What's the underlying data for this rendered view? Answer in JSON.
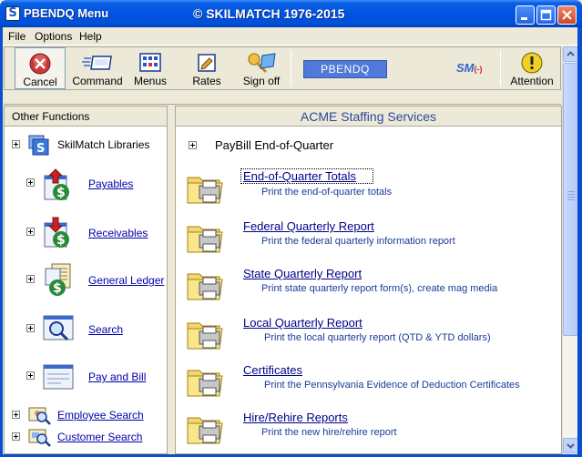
{
  "window": {
    "title": "PBENDQ Menu",
    "copyright": "© SKILMATCH 1976-2015",
    "app_icon_letter": "S"
  },
  "menubar": {
    "items": [
      "File",
      "Options",
      "Help"
    ]
  },
  "toolbar": {
    "buttons": [
      {
        "label": "Cancel",
        "icon": "cancel-icon"
      },
      {
        "label": "Command",
        "icon": "command-icon"
      },
      {
        "label": "Menus",
        "icon": "menus-icon"
      },
      {
        "label": "Rates",
        "icon": "rates-icon"
      },
      {
        "label": "Sign off",
        "icon": "sign-off-icon"
      },
      {
        "label": "Attention",
        "icon": "attention-icon"
      }
    ],
    "code": "PBENDQ",
    "logo": "SM",
    "logo_mark": "(-)"
  },
  "left_pane": {
    "header": "Other Functions",
    "items": [
      {
        "label": "SkilMatch Libraries",
        "icon": "libraries-icon",
        "link": false
      },
      {
        "label": "Payables",
        "icon": "payables-icon",
        "link": true
      },
      {
        "label": "Receivables",
        "icon": "receivables-icon",
        "link": true
      },
      {
        "label": "General Ledger",
        "icon": "general-ledger-icon",
        "link": true
      },
      {
        "label": "Search",
        "icon": "search-icon",
        "link": true
      },
      {
        "label": "Pay and Bill",
        "icon": "pay-and-bill-icon",
        "link": true
      },
      {
        "label": "Employee Search",
        "icon": "employee-search-icon",
        "link": true
      },
      {
        "label": "Customer Search",
        "icon": "customer-search-icon",
        "link": true
      }
    ]
  },
  "right_pane": {
    "header": "ACME Staffing Services",
    "section": "PayBill End-of-Quarter",
    "reports": [
      {
        "title": "End-of-Quarter Totals",
        "desc": "Print the end-of-quarter totals"
      },
      {
        "title": "Federal Quarterly Report",
        "desc": "Print the federal quarterly information report"
      },
      {
        "title": "State Quarterly Report",
        "desc": "Print state quarterly report form(s), create mag media"
      },
      {
        "title": "Local Quarterly Report",
        "desc": "Print the local quarterly report (QTD & YTD dollars)"
      },
      {
        "title": "Certificates",
        "desc": "Print the Pennsylvania Evidence of Deduction Certificates"
      },
      {
        "title": "Hire/Rehire Reports",
        "desc": "Print the new hire/rehire report"
      }
    ]
  },
  "colors": {
    "titlebar": "#0054e3",
    "link": "#0000aa",
    "header_text": "#2c4a9a",
    "code_box": "#5079d9"
  }
}
